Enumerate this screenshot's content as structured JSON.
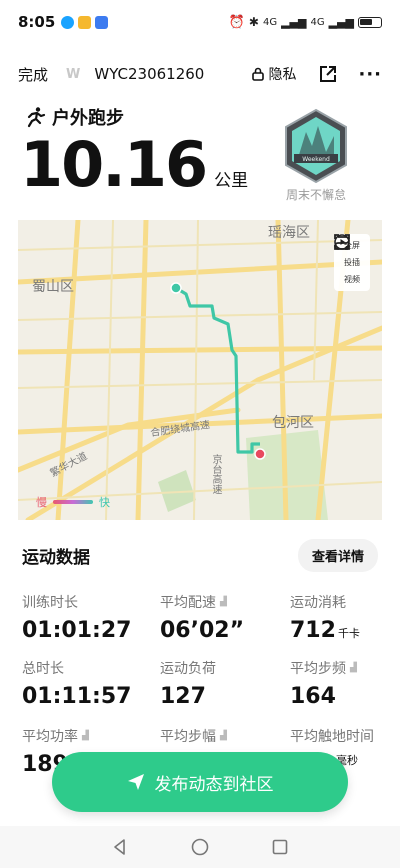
{
  "status_bar": {
    "time": "8:05",
    "network_1": "4G",
    "network_2": "4G"
  },
  "header": {
    "done_label": "完成",
    "logo_text": "W",
    "record_id": "WYC23061260",
    "privacy_label": "隐私"
  },
  "summary": {
    "activity_type": "户外跑步",
    "distance": "10.16",
    "distance_unit": "公里",
    "badge_text": "Weekend",
    "badge_caption": "周末不懈怠"
  },
  "map": {
    "labels": {
      "haishu": "瑶海区",
      "shushan": "蜀山区",
      "baohe": "包河区",
      "expressway": "合肥绕城高速",
      "road1": "繁华大道",
      "road2": "京台高速"
    },
    "controls": {
      "fullscreen": "全屏",
      "cast": "投插",
      "video": "视频"
    },
    "legend": {
      "slow": "慢",
      "fast": "快"
    },
    "colors": {
      "route": "#3fc7a6",
      "start": "#3fc7a6",
      "end": "#e84a5f",
      "park": "#d7e8c6",
      "road": "#f7dc8a"
    }
  },
  "stats": {
    "title": "运动数据",
    "details_label": "查看详情",
    "items": [
      {
        "label": "训练时长",
        "value": "01:01:27",
        "unit": ""
      },
      {
        "label": "平均配速",
        "value": "06’02”",
        "unit": ""
      },
      {
        "label": "运动消耗",
        "value": "712",
        "unit": "千卡"
      },
      {
        "label": "总时长",
        "value": "01:11:57",
        "unit": ""
      },
      {
        "label": "运动负荷",
        "value": "127",
        "unit": ""
      },
      {
        "label": "平均步频",
        "value": "164",
        "unit": ""
      },
      {
        "label": "平均功率",
        "value": "189",
        "unit": ""
      },
      {
        "label": "平均步幅",
        "value": "",
        "unit": ""
      },
      {
        "label": "平均触地时间",
        "value": "",
        "unit": "毫秒"
      }
    ]
  },
  "publish_label": "发布动态到社区",
  "accent_color": "#2ecb8b"
}
